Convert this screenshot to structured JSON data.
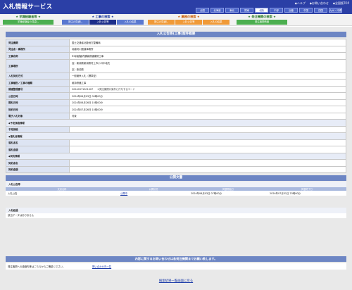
{
  "header": {
    "title": "入札情報サービス",
    "links": [
      "◆ヘルプ",
      "◆お問い合わせ",
      "◆全国版TOP"
    ],
    "regions": [
      "全国",
      "北海道",
      "東北",
      "関東",
      "北陸",
      "中部",
      "近畿",
      "中国",
      "四国",
      "九州・沖縄"
    ],
    "active_region": "北陸"
  },
  "nav": {
    "groups": [
      {
        "title": "★ 学識経験者等 ★",
        "color": "#2a7a2a",
        "tab_color": "#4caf50",
        "tabs": [
          "学識経験者の見直し"
        ]
      },
      {
        "title": "★ 工事の検索 ★",
        "color": "#1c3aa0",
        "tab_color": "#5a78d0",
        "tabs": [
          "発注の見通し",
          "入札公告等",
          "入札の結果"
        ],
        "selected": "入札公告等"
      },
      {
        "title": "★ 業務の検索 ★",
        "color": "#c85a00",
        "tab_color": "#f09a38",
        "tabs": [
          "発注の見通し",
          "入札公告等",
          "入札の結果"
        ]
      },
      {
        "title": "★ 発注機関の検索 ★",
        "color": "#2a7a2a",
        "tab_color": "#4caf50",
        "tabs": [
          "発注機関情報"
        ]
      }
    ]
  },
  "detail": {
    "section_title": "入札公告等(工事)案件概要",
    "rows": [
      {
        "label": "発注機関",
        "value": "国土交通省北陸地方整備局"
      },
      {
        "label": "発注者・事務所",
        "value": "羽越河川国道事務所"
      },
      {
        "label": "工事名称",
        "value": "R5羽越管内舗装修繕補修工事"
      },
      {
        "label": "工事場所",
        "value": "自）新潟県新潟県村上市小口中地先",
        "value2": "至）新潟県"
      },
      {
        "label": "入札契約方式",
        "value": "一般競争入札（標準型）"
      },
      {
        "label": "工事種別／工事の種類",
        "value": "維持修繕工事"
      },
      {
        "label": "調達整理番号",
        "value": "20240371301007",
        "note": "※発注機関が案件に付与するコード"
      },
      {
        "label": "公告日時",
        "value": "2024年06月03日 00時00分"
      },
      {
        "label": "開札日時",
        "value": "2024年06月26日 10時00分"
      },
      {
        "label": "契約日時",
        "value": "2024年07月26日 10時00分"
      },
      {
        "label": "電子入札対象",
        "value": "対象"
      }
    ],
    "subsections": [
      {
        "heading": "◆予定価格情報",
        "rows": [
          {
            "label": "予定価格",
            "value": ""
          }
        ]
      },
      {
        "heading": "◆落札者情報",
        "rows": [
          {
            "label": "落札者名",
            "value": ""
          },
          {
            "label": "落札金額",
            "value": ""
          }
        ]
      },
      {
        "heading": "◆契約情報",
        "rows": [
          {
            "label": "契約者名",
            "value": ""
          },
          {
            "label": "契約金額",
            "value": ""
          }
        ]
      }
    ]
  },
  "public_docs": {
    "title": "公開文書",
    "subtitle": "入札公告等",
    "columns": [
      "文書名称",
      "公開状況",
      "掲載開始日",
      "掲載終了日"
    ],
    "rows": [
      {
        "name": "入札公告",
        "status": "公開中",
        "start": "2024年06月03日 07時00分",
        "end": "2024年07月31日 23時00分"
      }
    ],
    "results_subtitle": "入札経過",
    "empty_message": "該当データはありません"
  },
  "inquiry": {
    "title": "内容に関するお問い合わせは各発注機関までお願い致します。",
    "contact_label": "発注機関への連絡先等はこちらからご確認ください。",
    "contact_link": "問い合わせ先一覧"
  },
  "footer": {
    "back_link": "検索結果一覧画面に戻る"
  }
}
